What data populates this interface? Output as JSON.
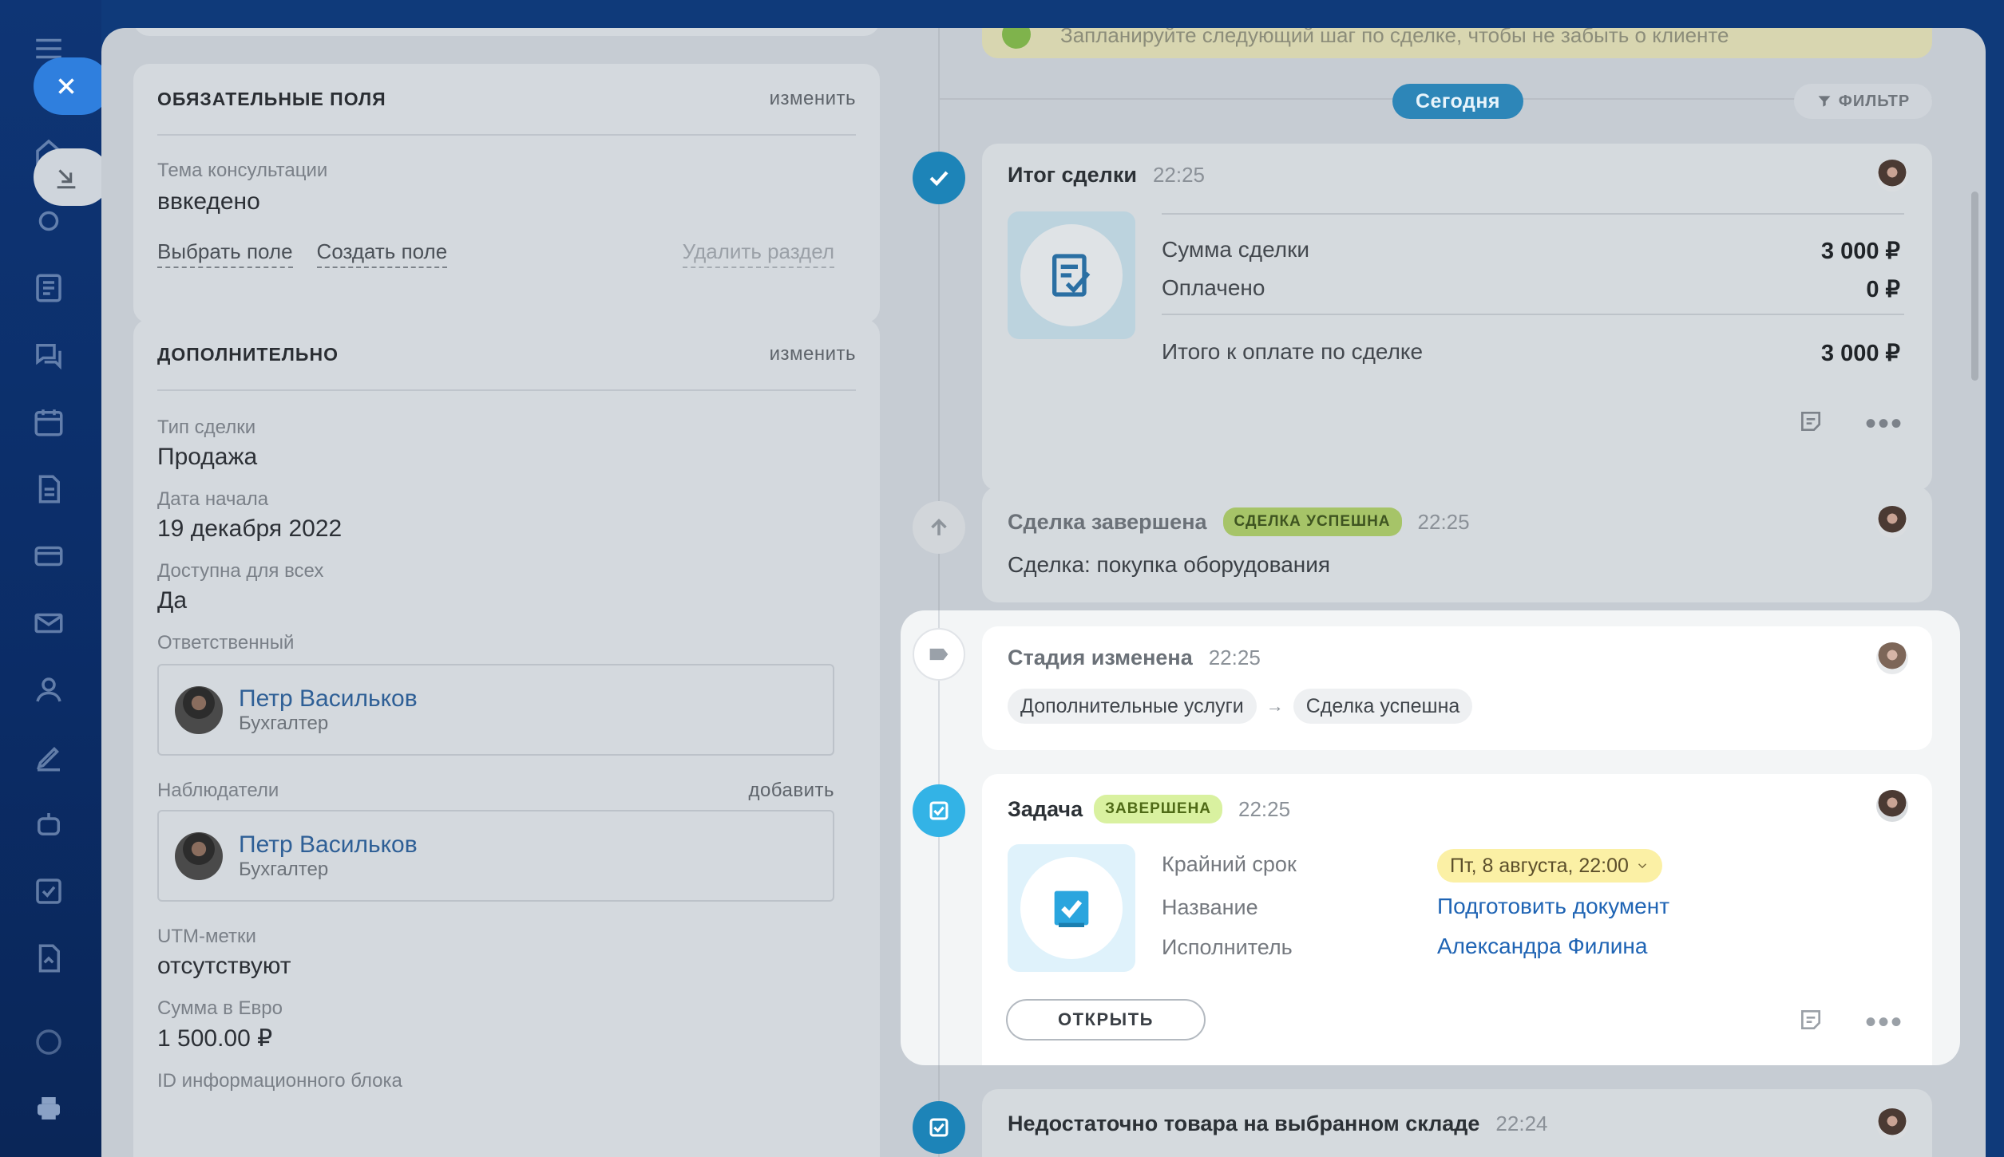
{
  "colors": {
    "accent": "#2f7fde",
    "success": "#9fca5a",
    "done_badge": "#d9f1a0",
    "timeline_blue": "#3bb7e6"
  },
  "nav": {
    "icons": [
      "menu-icon",
      "close-icon",
      "home-icon",
      "collapse-icon",
      "feed-icon",
      "chat-icon",
      "calendar-icon",
      "docs-icon",
      "card-icon",
      "mail-icon",
      "contacts-icon",
      "sign-icon",
      "robot-icon",
      "tasks-icon",
      "reports-icon",
      "settings-icon",
      "printer-icon"
    ]
  },
  "required_fields": {
    "title": "ОБЯЗАТЕЛЬНЫЕ ПОЛЯ",
    "edit": "изменить",
    "topic_label": "Тема консультации",
    "topic_value": "ввкедено",
    "select_field": "Выбрать поле",
    "create_field": "Создать поле",
    "delete_section": "Удалить раздел"
  },
  "additional": {
    "title": "ДОПОЛНИТЕЛЬНО",
    "edit": "изменить",
    "deal_type_label": "Тип сделки",
    "deal_type_value": "Продажа",
    "start_date_label": "Дата начала",
    "start_date_value": "19 декабря 2022",
    "available_label": "Доступна для всех",
    "available_value": "Да",
    "responsible_label": "Ответственный",
    "responsible_name": "Петр Васильков",
    "responsible_role": "Бухгалтер",
    "observers_label": "Наблюдатели",
    "observers_add": "добавить",
    "observer_name": "Петр Васильков",
    "observer_role": "Бухгалтер",
    "utm_label": "UTM-метки",
    "utm_value": "отсутствуют",
    "eur_label": "Сумма в Евро",
    "eur_value": "1 500.00 ₽",
    "block_id_label": "ID информационного блока"
  },
  "timeline": {
    "notice": "Запланируйте следующий шаг по сделке, чтобы не забыть о клиенте",
    "today": "Сегодня",
    "filter": "ФИЛЬТР",
    "result": {
      "title": "Итог сделки",
      "time": "22:25",
      "sum_label": "Сумма сделки",
      "sum_value": "3 000 ₽",
      "paid_label": "Оплачено",
      "paid_value": "0 ₽",
      "total_label": "Итого к оплате по сделке",
      "total_value": "3 000 ₽"
    },
    "closed": {
      "title": "Сделка завершена",
      "badge": "СДЕЛКА УСПЕШНА",
      "time": "22:25",
      "text": "Сделка: покупка оборудования"
    },
    "stage": {
      "title": "Стадия изменена",
      "time": "22:25",
      "from": "Дополнительные услуги",
      "arrow": "→",
      "to": "Сделка успешна"
    },
    "task": {
      "title": "Задача",
      "badge": "ЗАВЕРШЕНА",
      "time": "22:25",
      "deadline_label": "Крайний срок",
      "deadline_value": "Пт, 8 августа, 22:00",
      "name_label": "Название",
      "name_value": "Подготовить документ",
      "assignee_label": "Исполнитель",
      "assignee_value": "Александра Филина",
      "open_button": "ОТКРЫТЬ"
    },
    "stock": {
      "title": "Недостаточно товара на выбранном складе",
      "time": "22:24"
    }
  }
}
